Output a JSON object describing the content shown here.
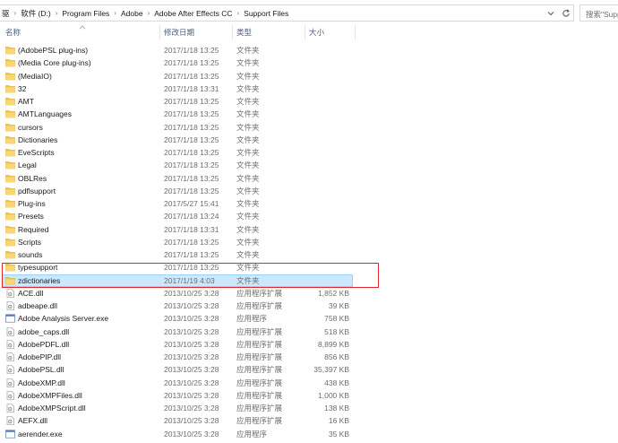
{
  "address": {
    "crumbs": [
      "驱",
      "软件 (D:)",
      "Program Files",
      "Adobe",
      "Adobe After Effects CC",
      "Support Files"
    ]
  },
  "search": {
    "placeholder": "搜索\"Supp"
  },
  "columns": {
    "name": "名称",
    "date": "修改日期",
    "type": "类型",
    "size": "大小"
  },
  "colors": {
    "folder": "#f5c342",
    "selection_fill": "#cce8ff",
    "selection_border": "#99d1ff",
    "highlight_box": "#e0262f",
    "header_text": "#4c607a"
  },
  "files": [
    {
      "name": "(AdobePSL plug-ins)",
      "date": "2017/1/18 13:25",
      "type": "文件夹",
      "size": "",
      "icon": "folder-icon"
    },
    {
      "name": "(Media Core plug-ins)",
      "date": "2017/1/18 13:25",
      "type": "文件夹",
      "size": "",
      "icon": "folder-icon"
    },
    {
      "name": "(MediaIO)",
      "date": "2017/1/18 13:25",
      "type": "文件夹",
      "size": "",
      "icon": "folder-icon"
    },
    {
      "name": "32",
      "date": "2017/1/18 13:31",
      "type": "文件夹",
      "size": "",
      "icon": "folder-icon"
    },
    {
      "name": "AMT",
      "date": "2017/1/18 13:25",
      "type": "文件夹",
      "size": "",
      "icon": "folder-icon"
    },
    {
      "name": "AMTLanguages",
      "date": "2017/1/18 13:25",
      "type": "文件夹",
      "size": "",
      "icon": "folder-icon"
    },
    {
      "name": "cursors",
      "date": "2017/1/18 13:25",
      "type": "文件夹",
      "size": "",
      "icon": "folder-icon"
    },
    {
      "name": "Dictionaries",
      "date": "2017/1/18 13:25",
      "type": "文件夹",
      "size": "",
      "icon": "folder-icon"
    },
    {
      "name": "EveScripts",
      "date": "2017/1/18 13:25",
      "type": "文件夹",
      "size": "",
      "icon": "folder-icon"
    },
    {
      "name": "Legal",
      "date": "2017/1/18 13:25",
      "type": "文件夹",
      "size": "",
      "icon": "folder-icon"
    },
    {
      "name": "OBLRes",
      "date": "2017/1/18 13:25",
      "type": "文件夹",
      "size": "",
      "icon": "folder-icon"
    },
    {
      "name": "pdflsupport",
      "date": "2017/1/18 13:25",
      "type": "文件夹",
      "size": "",
      "icon": "folder-icon"
    },
    {
      "name": "Plug-ins",
      "date": "2017/5/27 15:41",
      "type": "文件夹",
      "size": "",
      "icon": "folder-icon"
    },
    {
      "name": "Presets",
      "date": "2017/1/18 13:24",
      "type": "文件夹",
      "size": "",
      "icon": "folder-icon"
    },
    {
      "name": "Required",
      "date": "2017/1/18 13:31",
      "type": "文件夹",
      "size": "",
      "icon": "folder-icon"
    },
    {
      "name": "Scripts",
      "date": "2017/1/18 13:25",
      "type": "文件夹",
      "size": "",
      "icon": "folder-icon"
    },
    {
      "name": "sounds",
      "date": "2017/1/18 13:25",
      "type": "文件夹",
      "size": "",
      "icon": "folder-icon"
    },
    {
      "name": "typesupport",
      "date": "2017/1/18 13:25",
      "type": "文件夹",
      "size": "",
      "icon": "folder-icon"
    },
    {
      "name": "zdictionaries",
      "date": "2017/1/19 4:03",
      "type": "文件夹",
      "size": "",
      "icon": "folder-icon",
      "selected": true
    },
    {
      "name": "ACE.dll",
      "date": "2013/10/25 3:28",
      "type": "应用程序扩展",
      "size": "1,852 KB",
      "icon": "dll-icon"
    },
    {
      "name": "adbeape.dll",
      "date": "2013/10/25 3:28",
      "type": "应用程序扩展",
      "size": "39 KB",
      "icon": "dll-icon"
    },
    {
      "name": "Adobe Analysis Server.exe",
      "date": "2013/10/25 3:28",
      "type": "应用程序",
      "size": "758 KB",
      "icon": "exe-icon"
    },
    {
      "name": "adobe_caps.dll",
      "date": "2013/10/25 3:28",
      "type": "应用程序扩展",
      "size": "518 KB",
      "icon": "dll-icon"
    },
    {
      "name": "AdobePDFL.dll",
      "date": "2013/10/25 3:28",
      "type": "应用程序扩展",
      "size": "8,899 KB",
      "icon": "dll-icon"
    },
    {
      "name": "AdobePIP.dll",
      "date": "2013/10/25 3:28",
      "type": "应用程序扩展",
      "size": "856 KB",
      "icon": "dll-icon"
    },
    {
      "name": "AdobePSL.dll",
      "date": "2013/10/25 3:28",
      "type": "应用程序扩展",
      "size": "35,397 KB",
      "icon": "dll-icon"
    },
    {
      "name": "AdobeXMP.dll",
      "date": "2013/10/25 3:28",
      "type": "应用程序扩展",
      "size": "438 KB",
      "icon": "dll-icon"
    },
    {
      "name": "AdobeXMPFiles.dll",
      "date": "2013/10/25 3:28",
      "type": "应用程序扩展",
      "size": "1,000 KB",
      "icon": "dll-icon"
    },
    {
      "name": "AdobeXMPScript.dll",
      "date": "2013/10/25 3:28",
      "type": "应用程序扩展",
      "size": "138 KB",
      "icon": "dll-icon"
    },
    {
      "name": "AEFX.dll",
      "date": "2013/10/25 3:28",
      "type": "应用程序扩展",
      "size": "16 KB",
      "icon": "dll-icon"
    },
    {
      "name": "aerender.exe",
      "date": "2013/10/25 3:28",
      "type": "应用程序",
      "size": "35 KB",
      "icon": "exe-icon"
    }
  ]
}
